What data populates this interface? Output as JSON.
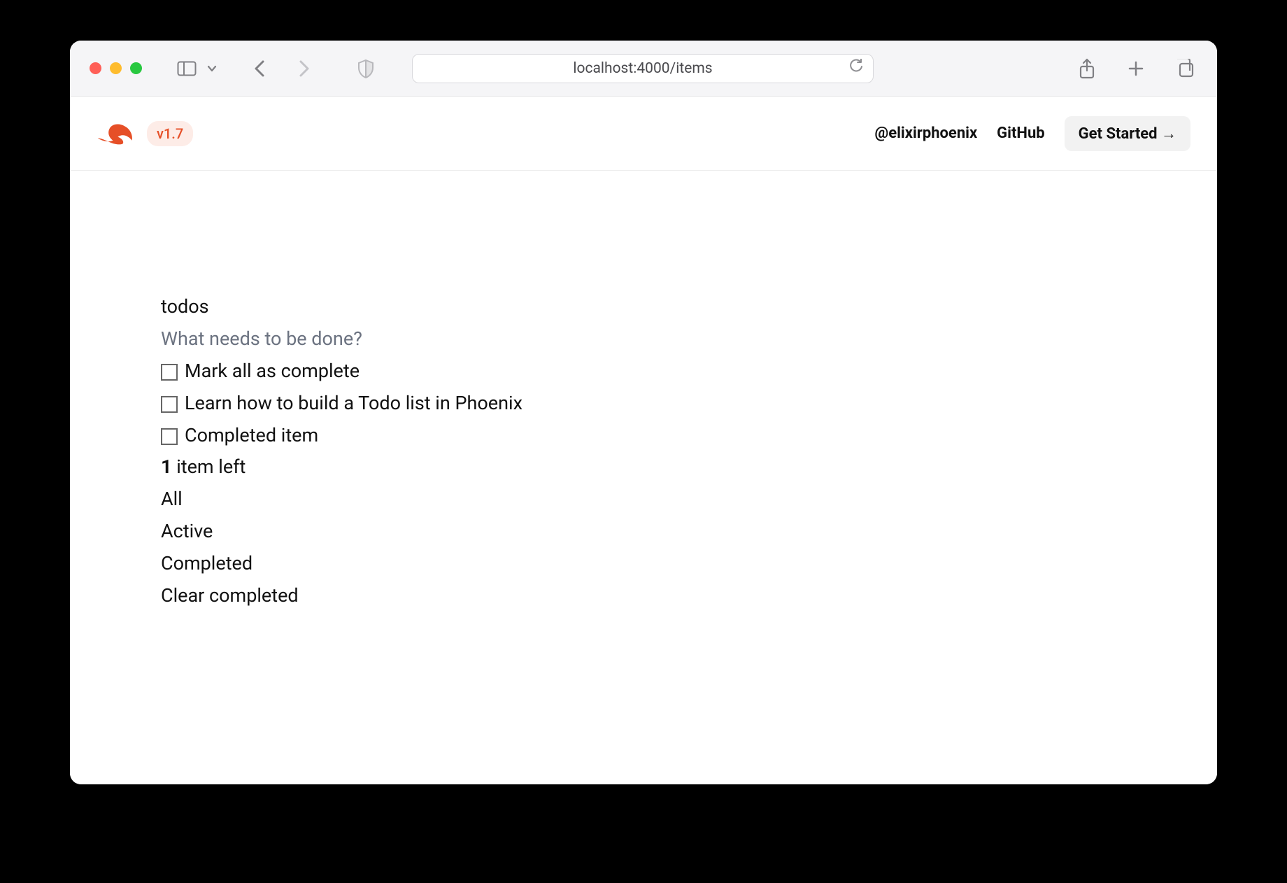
{
  "browser": {
    "url": "localhost:4000/items"
  },
  "header": {
    "version": "v1.7",
    "twitter": "@elixirphoenix",
    "github": "GitHub",
    "get_started": "Get Started →"
  },
  "todos": {
    "title": "todos",
    "placeholder": "What needs to be done?",
    "toggle_all_label": "Mark all as complete",
    "items": [
      {
        "label": "Learn how to build a Todo list in Phoenix",
        "checked": false
      },
      {
        "label": "Completed item",
        "checked": false
      }
    ],
    "count_number": "1",
    "count_text": " item left",
    "filters": {
      "all": "All",
      "active": "Active",
      "completed": "Completed"
    },
    "clear_completed": "Clear completed"
  }
}
